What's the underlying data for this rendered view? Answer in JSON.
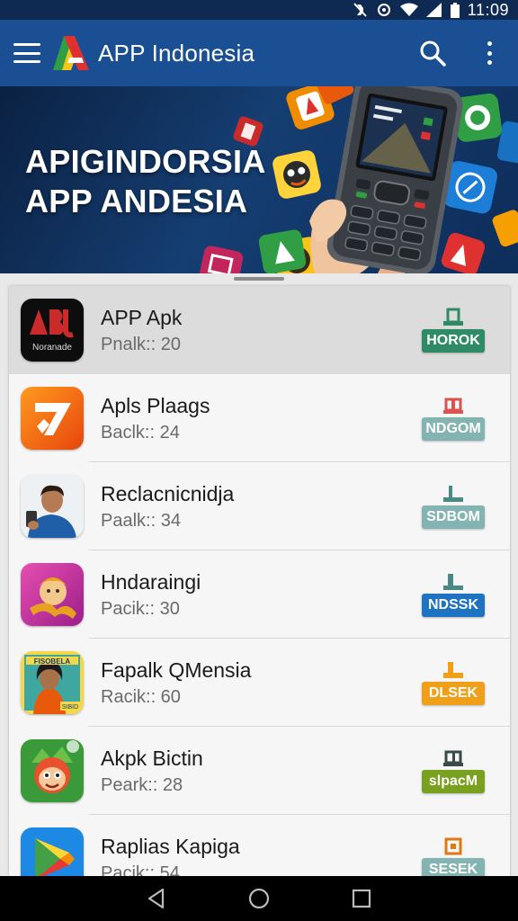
{
  "status_bar": {
    "time": "11:09"
  },
  "app_bar": {
    "title": "APP Indonesia"
  },
  "banner": {
    "line1": "APIGINDORSIA",
    "line2": "APP ANDESIA"
  },
  "apps": [
    {
      "name": "APP Apk",
      "sub": "Pnalk:: 20",
      "badge": "HOROK",
      "badge_color": "#2e8b66",
      "glyph_color": "#2e8b66",
      "icon": "apk-icon",
      "selected": true
    },
    {
      "name": "Apls Plaags",
      "sub": "Baclk:: 24",
      "badge": "NDGOM",
      "badge_color": "#83b4b2",
      "glyph_color": "#d9534f",
      "icon": "play-apps-icon",
      "selected": false
    },
    {
      "name": "Reclacnicnidja",
      "sub": "Paalk:: 34",
      "badge": "SDBOM",
      "badge_color": "#83b4b2",
      "glyph_color": "#4a8a86",
      "icon": "person-icon",
      "selected": false
    },
    {
      "name": "Hndaraingi",
      "sub": "Pacik:: 30",
      "badge": "NDSSK",
      "badge_color": "#1e74c2",
      "glyph_color": "#4a8a86",
      "icon": "dancer-icon",
      "selected": false
    },
    {
      "name": "Fapalk QMensia",
      "sub": "Racik:: 60",
      "badge": "DLSEK",
      "badge_color": "#f0a018",
      "glyph_color": "#f0a018",
      "icon": "woman-icon",
      "selected": false
    },
    {
      "name": "Akpk Bictin",
      "sub": "Peark:: 28",
      "badge": "slpacM",
      "badge_color": "#7aa020",
      "glyph_color": "#3a4a4a",
      "icon": "cartoon-face-icon",
      "selected": false
    },
    {
      "name": "Raplias Kapiga",
      "sub": "Pacik:: 54",
      "badge": "SESEK",
      "badge_color": "#83b4b2",
      "glyph_color": "#e07a10",
      "icon": "play-store-icon",
      "selected": false
    }
  ]
}
